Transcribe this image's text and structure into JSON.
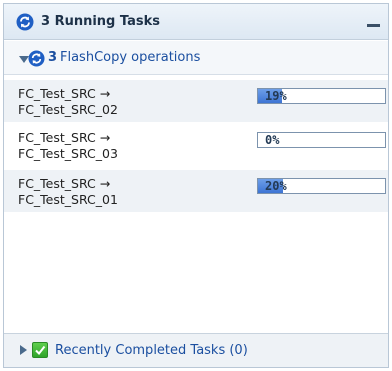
{
  "header": {
    "title": "3 Running Tasks",
    "icon": "sync-icon",
    "minimize_icon": "minimize-icon"
  },
  "group": {
    "count": "3",
    "label": "FlashCopy operations",
    "expand_icon": "expanded-triangle-icon",
    "icon": "sync-icon"
  },
  "tasks": [
    {
      "source": "FC_Test_SRC →",
      "target": "FC_Test_SRC_02",
      "progress": 19,
      "progress_label": "19%"
    },
    {
      "source": "FC_Test_SRC →",
      "target": "FC_Test_SRC_03",
      "progress": 0,
      "progress_label": "0%"
    },
    {
      "source": "FC_Test_SRC →",
      "target": "FC_Test_SRC_01",
      "progress": 20,
      "progress_label": "20%"
    }
  ],
  "footer": {
    "label": "Recently Completed Tasks (0)",
    "expand_icon": "collapsed-triangle-icon",
    "icon": "green-check-icon"
  },
  "colors": {
    "accent": "#1b4fa0",
    "progress_fill": "#3d74d4",
    "success": "#2fa32a"
  }
}
